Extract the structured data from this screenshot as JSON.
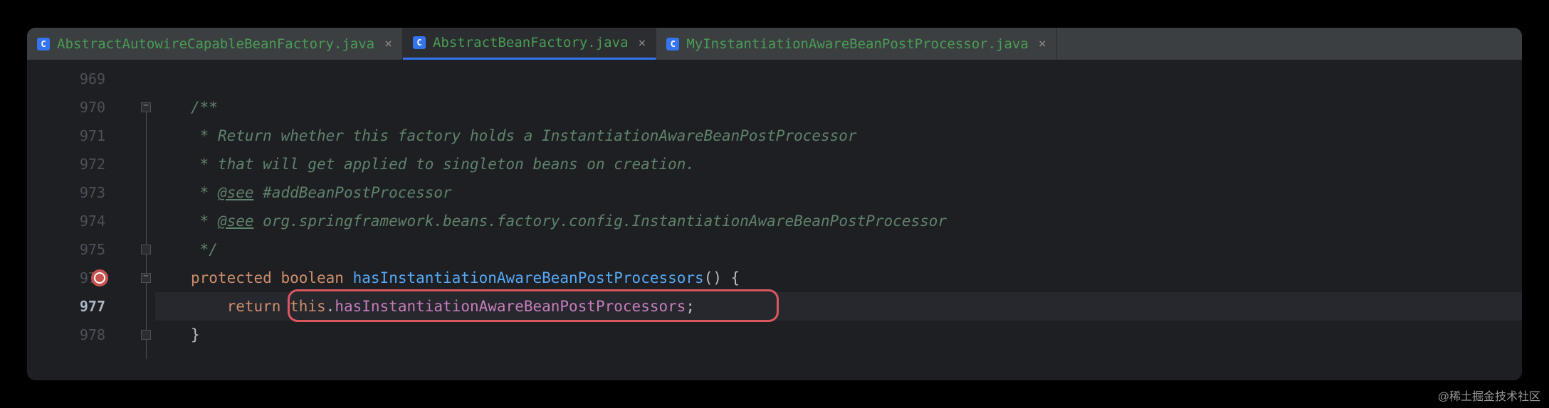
{
  "tabs": [
    {
      "name": "AbstractAutowireCapableBeanFactory.java",
      "active": false
    },
    {
      "name": "AbstractBeanFactory.java",
      "active": true
    },
    {
      "name": "MyInstantiationAwareBeanPostProcessor.java",
      "active": false
    }
  ],
  "gutter": {
    "lines": [
      "969",
      "970",
      "971",
      "972",
      "973",
      "974",
      "975",
      "976",
      "977",
      "978"
    ],
    "current": "977",
    "breakpoint_line": "976",
    "bulb_line": "977"
  },
  "code": {
    "l970": "/**",
    "l971_prefix": " * ",
    "l971_text": "Return whether this factory holds a InstantiationAwareBeanPostProcessor",
    "l972_prefix": " * ",
    "l972_text": "that will get applied to singleton beans on creation.",
    "l973_prefix": " * ",
    "l973_see": "@see",
    "l973_ref": " #addBeanPostProcessor",
    "l974_prefix": " * ",
    "l974_see": "@see",
    "l974_ref": " org.springframework.beans.factory.config.InstantiationAwareBeanPostProcessor",
    "l975": " */",
    "l976_protected": "protected",
    "l976_boolean": "boolean",
    "l976_method": "hasInstantiationAwareBeanPostProcessors",
    "l976_parens": "()",
    "l976_brace": " {",
    "l977_return": "return",
    "l977_this": "this",
    "l977_dot": ".",
    "l977_field": "hasInstantiationAwareBeanPostProcessors",
    "l977_semi": ";",
    "l978": "}"
  },
  "watermark": "@稀土掘金技术社区"
}
